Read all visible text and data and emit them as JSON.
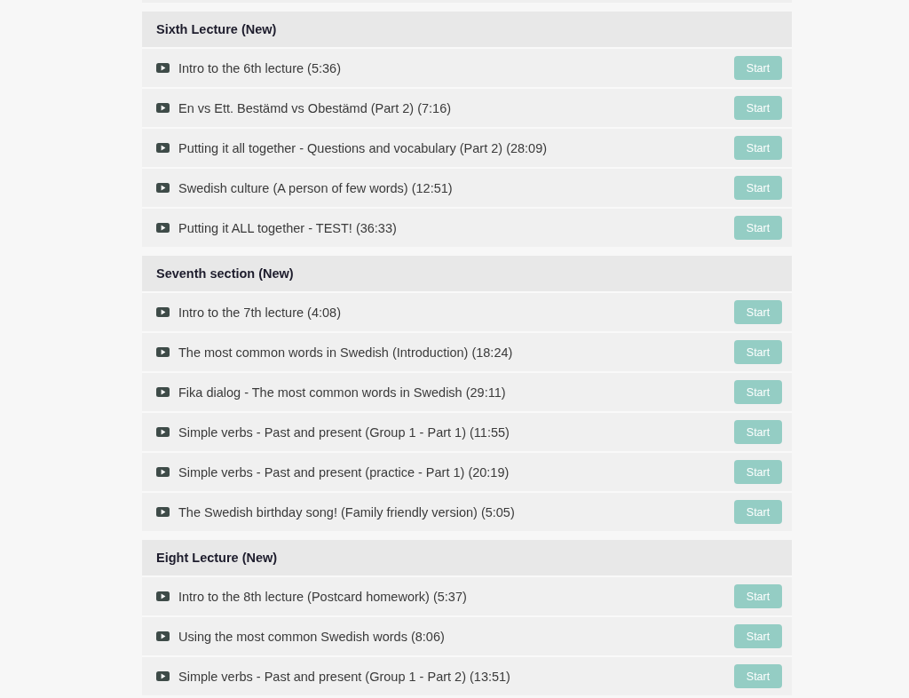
{
  "sections": [
    {
      "title": "Sixth Lecture (New)",
      "lessons": [
        {
          "title": "Intro to the 6th lecture (5:36)",
          "button": "Start"
        },
        {
          "title": "En vs Ett. Bestämd vs Obestämd (Part 2) (7:16)",
          "button": "Start"
        },
        {
          "title": "Putting it all together - Questions and vocabulary (Part 2) (28:09)",
          "button": "Start"
        },
        {
          "title": "Swedish culture (A person of few words) (12:51)",
          "button": "Start"
        },
        {
          "title": "Putting it ALL together - TEST! (36:33)",
          "button": "Start"
        }
      ]
    },
    {
      "title": "Seventh section (New)",
      "lessons": [
        {
          "title": "Intro to the 7th lecture (4:08)",
          "button": "Start"
        },
        {
          "title": "The most common words in Swedish (Introduction) (18:24)",
          "button": "Start"
        },
        {
          "title": "Fika dialog - The most common words in Swedish (29:11)",
          "button": "Start"
        },
        {
          "title": "Simple verbs - Past and present (Group 1 - Part 1) (11:55)",
          "button": "Start"
        },
        {
          "title": "Simple verbs - Past and present (practice - Part 1) (20:19)",
          "button": "Start"
        },
        {
          "title": "The Swedish birthday song! (Family friendly version) (5:05)",
          "button": "Start"
        }
      ]
    },
    {
      "title": "Eight Lecture (New)",
      "lessons": [
        {
          "title": "Intro to the 8th lecture (Postcard homework) (5:37)",
          "button": "Start"
        },
        {
          "title": "Using the most common Swedish words (8:06)",
          "button": "Start"
        },
        {
          "title": "Simple verbs - Past and present (Group 1 - Part 2) (13:51)",
          "button": "Start"
        }
      ]
    }
  ]
}
